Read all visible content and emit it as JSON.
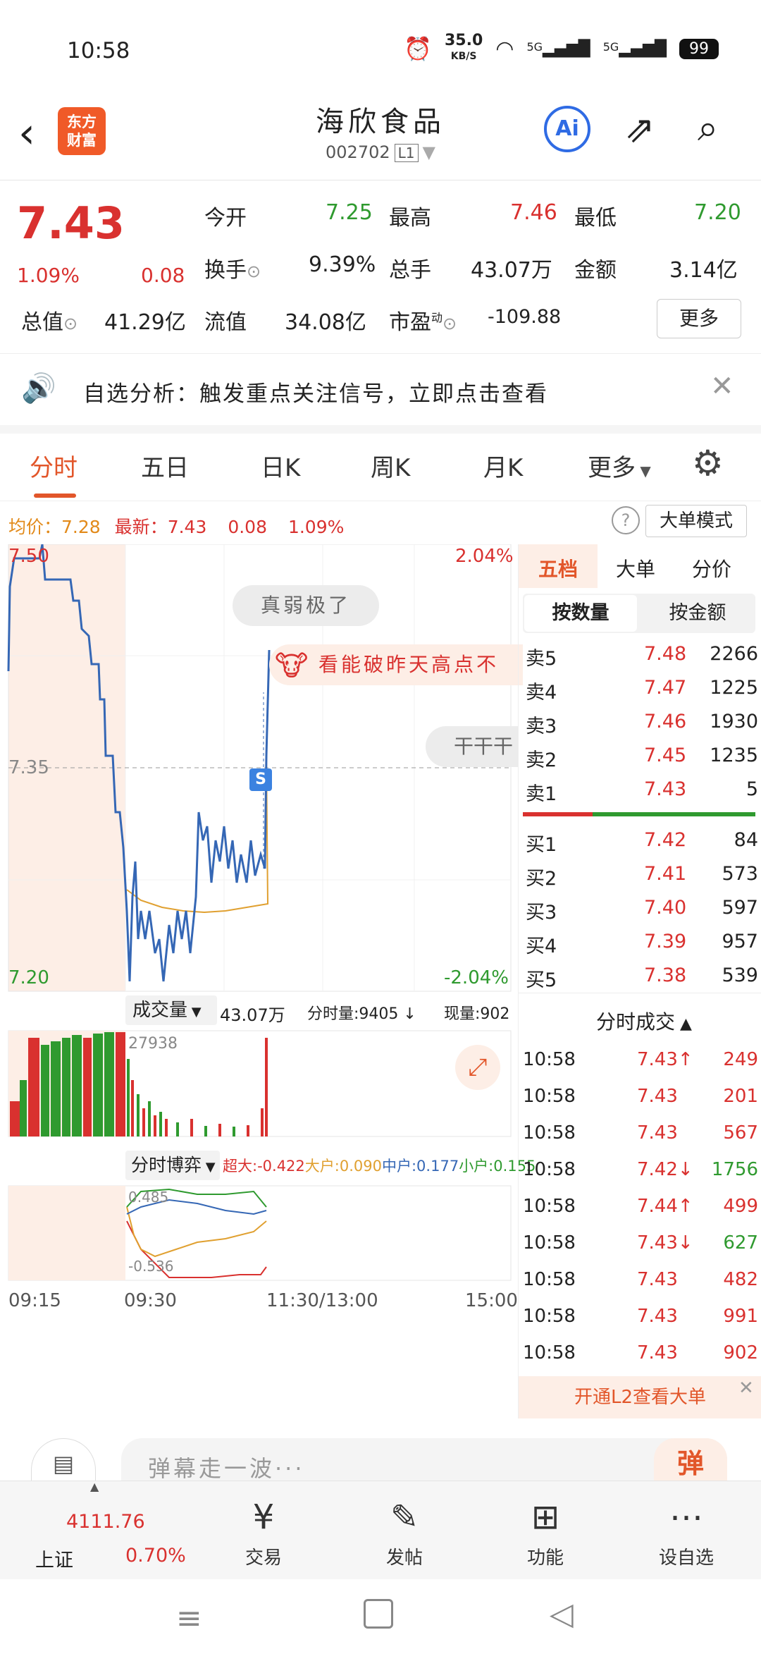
{
  "status_bar": {
    "time": "10:58",
    "net_speed": "35.0",
    "net_unit": "KB/S",
    "sig1": "5G",
    "sig2": "5G",
    "battery": "99"
  },
  "header": {
    "logo_line1": "东方",
    "logo_line2": "财富",
    "title": "海欣食品",
    "code": "002702",
    "level": "L1",
    "ai": "Ai"
  },
  "quote": {
    "price": "7.43",
    "change_pct": "1.09%",
    "change": "0.08",
    "open_label": "今开",
    "open": "7.25",
    "high_label": "最高",
    "high": "7.46",
    "low_label": "最低",
    "low": "7.20",
    "turnover_label": "换手",
    "turnover": "9.39%",
    "volume_label": "总手",
    "volume": "43.07万",
    "amount_label": "金额",
    "amount": "3.14亿",
    "mcap_label": "总值",
    "mcap": "41.29亿",
    "float_label": "流值",
    "float_value": "34.08亿",
    "pe_label": "市盈",
    "pe_sup": "动",
    "pe": "-109.88",
    "more": "更多"
  },
  "notice": {
    "text": "自选分析：触发重点关注信号，立即点击查看"
  },
  "tabs": [
    "分时",
    "五日",
    "日K",
    "周K",
    "月K",
    "更多"
  ],
  "avg_row": {
    "avg_label": "均价",
    "avg": "7.28",
    "latest_label": "最新",
    "latest": "7.43",
    "chg": "0.08",
    "pct": "1.09%",
    "mode_btn": "大单模式"
  },
  "chart": {
    "y_top": "7.50",
    "y_mid": "7.35",
    "y_bottom": "7.20",
    "pct_top": "2.04%",
    "pct_bottom": "-2.04%",
    "danmaku1": "真弱极了",
    "danmaku2": "看能破昨天高点不",
    "danmaku3": "干干干",
    "marker": "S",
    "vol_selector": "成交量",
    "vol_total": "43.07万",
    "vol_tick_label": "分时量:9405",
    "vol_now_label": "现量:902",
    "vol_max": "27938",
    "game_selector": "分时博弈",
    "super_label": "超大:-0.422",
    "large_label": "大户:0.090",
    "mid_label": "中户:0.177",
    "small_label": "小户:0.155",
    "game_top": "0.485",
    "game_bottom": "-0.536",
    "times": [
      "09:15",
      "09:30",
      "11:30/13:00",
      "15:00"
    ]
  },
  "chart_data": {
    "type": "line",
    "x": [
      "09:15",
      "09:30",
      "10:58"
    ],
    "series": [],
    "ylim": [
      7.2,
      7.5
    ]
  },
  "book": {
    "tabs": [
      "五档",
      "大单",
      "分价"
    ],
    "sub_tabs": [
      "按数量",
      "按金额"
    ],
    "asks": [
      {
        "label": "卖5",
        "price": "7.48",
        "vol": "2266"
      },
      {
        "label": "卖4",
        "price": "7.47",
        "vol": "1225"
      },
      {
        "label": "卖3",
        "price": "7.46",
        "vol": "1930"
      },
      {
        "label": "卖2",
        "price": "7.45",
        "vol": "1235"
      },
      {
        "label": "卖1",
        "price": "7.43",
        "vol": "5"
      }
    ],
    "bids": [
      {
        "label": "买1",
        "price": "7.42",
        "vol": "84"
      },
      {
        "label": "买2",
        "price": "7.41",
        "vol": "573"
      },
      {
        "label": "买3",
        "price": "7.40",
        "vol": "597"
      },
      {
        "label": "买4",
        "price": "7.39",
        "vol": "957"
      },
      {
        "label": "买5",
        "price": "7.38",
        "vol": "539"
      }
    ],
    "trades_title": "分时成交",
    "trades": [
      {
        "time": "10:58",
        "price": "7.43↑",
        "vol": "249"
      },
      {
        "time": "10:58",
        "price": "7.43",
        "vol": "201"
      },
      {
        "time": "10:58",
        "price": "7.43",
        "vol": "567"
      },
      {
        "time": "10:58",
        "price": "7.42↓",
        "vol": "1756"
      },
      {
        "time": "10:58",
        "price": "7.44↑",
        "vol": "499"
      },
      {
        "time": "10:58",
        "price": "7.43↓",
        "vol": "627"
      },
      {
        "time": "10:58",
        "price": "7.43",
        "vol": "482"
      },
      {
        "time": "10:58",
        "price": "7.43",
        "vol": "991"
      },
      {
        "time": "10:58",
        "price": "7.43",
        "vol": "902"
      }
    ],
    "l2_banner": "开通L2查看大单"
  },
  "comment": {
    "placeholder": "弹幕走一波···",
    "danmu_btn": "弹"
  },
  "bottom_nav": {
    "index_name": "上证",
    "index_value": "4111.76",
    "index_pct": "0.70%",
    "items": [
      "交易",
      "发帖",
      "功能",
      "设自选"
    ]
  }
}
